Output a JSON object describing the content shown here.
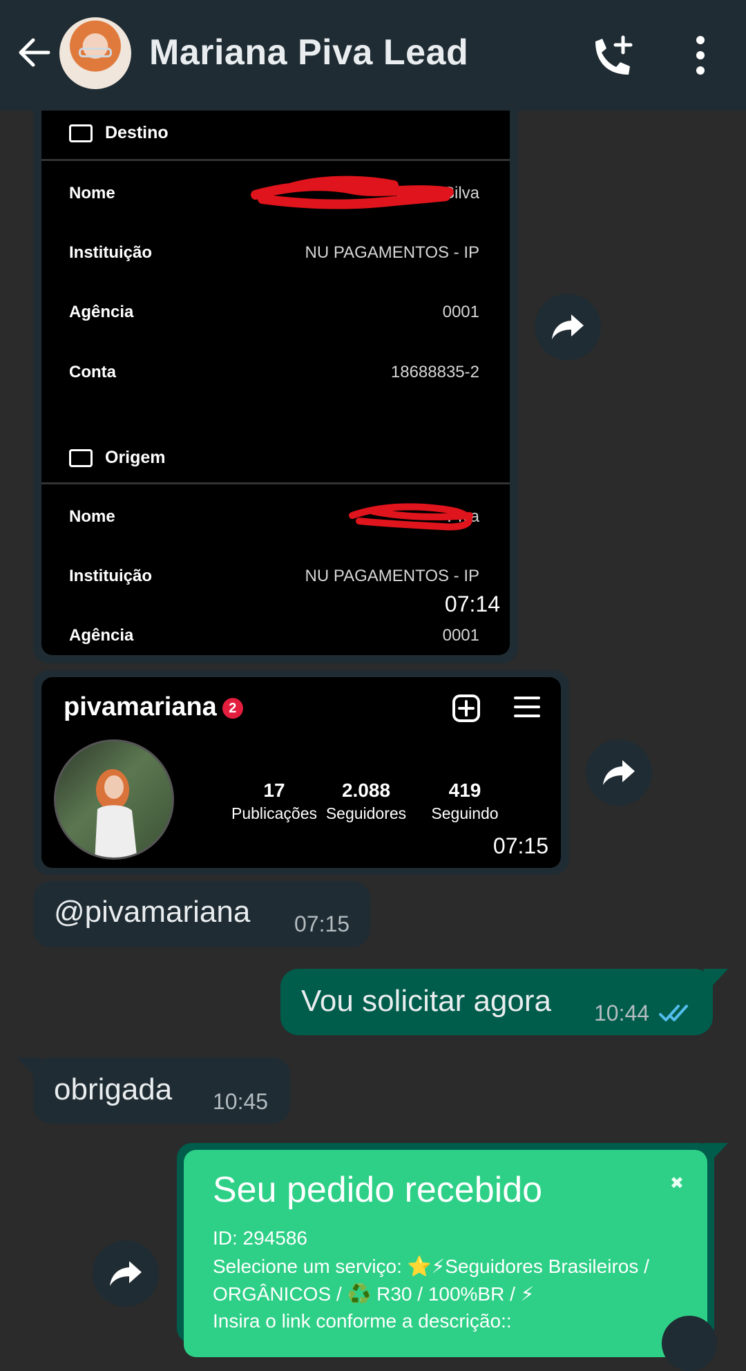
{
  "header": {
    "contact_name": "Mariana Piva Lead"
  },
  "bank_screenshot": {
    "destino_label": "Destino",
    "destino_rows": [
      {
        "label": "Nome",
        "value": "Paulo Silva"
      },
      {
        "label": "Instituição",
        "value": "NU PAGAMENTOS - IP"
      },
      {
        "label": "Agência",
        "value": "0001"
      },
      {
        "label": "Conta",
        "value": "18688835-2"
      }
    ],
    "origem_label": "Origem",
    "origem_rows": [
      {
        "label": "Nome",
        "value": "Piva"
      },
      {
        "label": "Instituição",
        "value": "NU PAGAMENTOS - IP"
      },
      {
        "label": "Agência",
        "value": "0001"
      }
    ],
    "time": "07:14"
  },
  "instagram_screenshot": {
    "username": "pivamariana",
    "badge": "2",
    "stats": [
      {
        "number": "17",
        "label": "Publicações"
      },
      {
        "number": "2.088",
        "label": "Seguidores"
      },
      {
        "number": "419",
        "label": "Seguindo"
      }
    ],
    "time": "07:15"
  },
  "messages": [
    {
      "text": "@pivamariana",
      "time": "07:15",
      "direction": "in"
    },
    {
      "text": "Vou solicitar agora",
      "time": "10:44",
      "direction": "out"
    },
    {
      "text": "obrigada",
      "time": "10:45",
      "direction": "in"
    }
  ],
  "promo_card": {
    "title": "Seu pedido recebido",
    "id_line": "ID: 294586",
    "service_line_1": "Selecione um serviço: ⭐⚡Seguidores Brasileiros /",
    "service_line_2": "ORGÂNICOS / ♻️ R30 / 100%BR / ⚡",
    "link_line": "Insira o link conforme a descrição::",
    "close_glyph": "✖"
  },
  "colors": {
    "header_bg": "#1f2c33",
    "chat_bg": "#2b2b2b",
    "incoming_bubble": "#1f2c33",
    "outgoing_bubble": "#005c4b",
    "read_ticks": "#53bdeb",
    "promo_green": "#2ed087"
  },
  "icons": [
    "back-arrow-icon",
    "add-call-icon",
    "more-vert-icon",
    "forward-icon",
    "read-ticks-icon",
    "add-post-icon",
    "hamburger-menu-icon"
  ]
}
